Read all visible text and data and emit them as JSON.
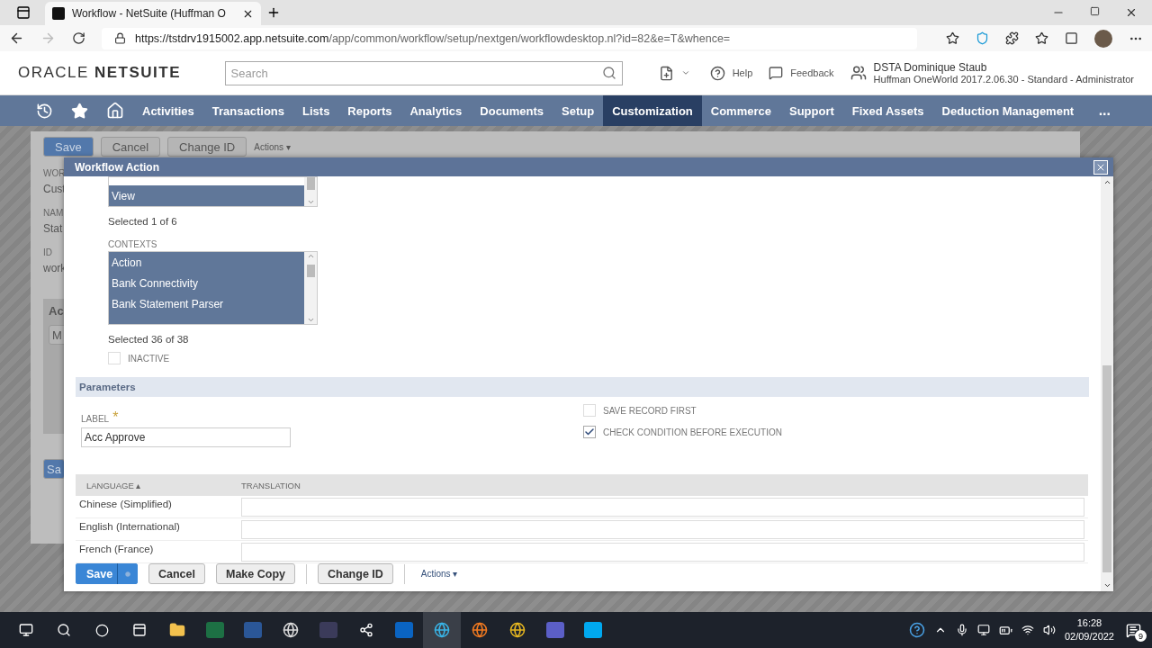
{
  "browser": {
    "tab_title": "Workflow - NetSuite (Huffman O",
    "url_host": "https://tstdrv1915002.app.netsuite.com",
    "url_path": "/app/common/workflow/setup/nextgen/workflowdesktop.nl?id=82&e=T&whence="
  },
  "header": {
    "logo_a": "ORACLE",
    "logo_b": "NETSUITE",
    "search_placeholder": "Search",
    "help": "Help",
    "feedback": "Feedback",
    "user_name": "DSTA Dominique Staub",
    "user_role": "Huffman OneWorld 2017.2.06.30 - Standard - Administrator"
  },
  "nav": [
    {
      "label": "Activities",
      "selected": false
    },
    {
      "label": "Transactions",
      "selected": false
    },
    {
      "label": "Lists",
      "selected": false
    },
    {
      "label": "Reports",
      "selected": false
    },
    {
      "label": "Analytics",
      "selected": false
    },
    {
      "label": "Documents",
      "selected": false
    },
    {
      "label": "Setup",
      "selected": false
    },
    {
      "label": "Customization",
      "selected": true
    },
    {
      "label": "Commerce",
      "selected": false
    },
    {
      "label": "Support",
      "selected": false
    },
    {
      "label": "Fixed Assets",
      "selected": false
    },
    {
      "label": "Deduction Management",
      "selected": false
    }
  ],
  "nav_more": "...",
  "background_page": {
    "buttons": [
      "Save",
      "Cancel",
      "Change ID"
    ],
    "actions": "Actions ▾",
    "fields": [
      {
        "label": "WOR",
        "value": "Cust"
      },
      {
        "label": "NAM",
        "value": "Stat"
      },
      {
        "label": "ID",
        "value": "work"
      }
    ],
    "section": "Ac",
    "section_button": "M",
    "bottom_button": "Sa"
  },
  "dialog": {
    "title": "Workflow Action",
    "events_list": {
      "items": [
        {
          "label": "View",
          "selected": true
        }
      ],
      "summary": "Selected 1 of 6"
    },
    "contexts": {
      "label": "CONTEXTS",
      "items": [
        {
          "label": "Action",
          "selected": true
        },
        {
          "label": "Bank Connectivity",
          "selected": true
        },
        {
          "label": "Bank Statement Parser",
          "selected": true
        }
      ],
      "summary": "Selected 36 of 38"
    },
    "inactive": {
      "label": "INACTIVE",
      "checked": false
    },
    "section": "Parameters",
    "label_field": {
      "label": "LABEL",
      "required": "*",
      "value": "Acc Approve"
    },
    "options": [
      {
        "label": "SAVE RECORD FIRST",
        "checked": false
      },
      {
        "label": "CHECK CONDITION BEFORE EXECUTION",
        "checked": true
      }
    ],
    "table": {
      "columns": [
        "LANGUAGE ▴",
        "TRANSLATION"
      ],
      "rows": [
        {
          "language": "Chinese (Simplified)"
        },
        {
          "language": "English (International)"
        },
        {
          "language": "French (France)"
        }
      ]
    },
    "buttons": [
      "Save",
      "Cancel",
      "Make Copy",
      "Change ID"
    ],
    "actions": "Actions ▾"
  },
  "taskbar": {
    "time": "16:28",
    "date": "02/09/2022",
    "notifications": "9"
  }
}
